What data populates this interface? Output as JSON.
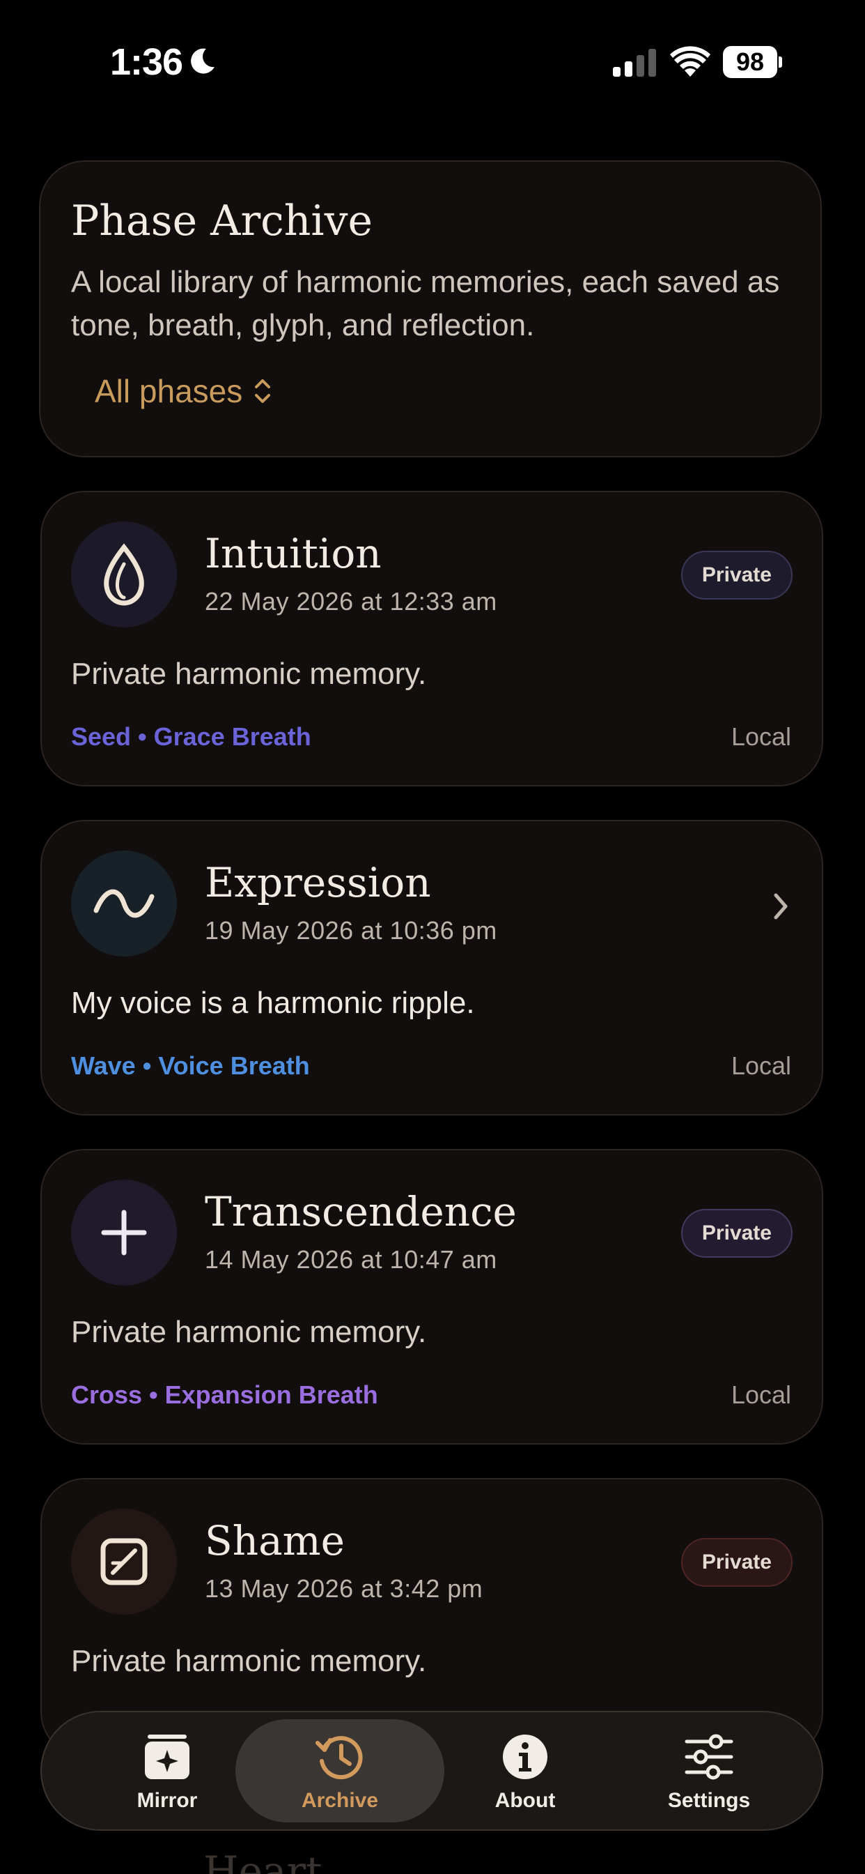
{
  "status_bar": {
    "time": "1:36",
    "battery": "98",
    "icons": [
      "moon-icon",
      "signal-icon",
      "wifi-icon",
      "battery-icon"
    ]
  },
  "header": {
    "title": "Phase Archive",
    "description": "A local library of harmonic memories, each saved as tone, breath, glyph, and reflection.",
    "filter_label": "All phases"
  },
  "entries": [
    {
      "title": "Intuition",
      "date": "22 May 2026 at 12:33 am",
      "badge": "Private",
      "text": "Private harmonic memory.",
      "tags": "Seed • Grace Breath",
      "storage": "Local",
      "icon": "seed-glyph-icon",
      "tag_color": "#6b63d8"
    },
    {
      "title": "Expression",
      "date": "19 May 2026 at 10:36 pm",
      "text": "My voice is a harmonic ripple.",
      "tags": "Wave • Voice Breath",
      "storage": "Local",
      "icon": "wave-glyph-icon",
      "tag_color": "#4f8fe0"
    },
    {
      "title": "Transcendence",
      "date": "14 May 2026 at 10:47 am",
      "badge": "Private",
      "text": "Private harmonic memory.",
      "tags": "Cross • Expansion Breath",
      "storage": "Local",
      "icon": "cross-glyph-icon",
      "tag_color": "#9b6ee0"
    },
    {
      "title": "Shame",
      "date": "13 May 2026 at 3:42 pm",
      "badge": "Private",
      "text": "Private harmonic memory.",
      "icon": "slashed-square-glyph-icon"
    }
  ],
  "peek_entry": {
    "title": "Heart"
  },
  "tab_bar": {
    "tabs": [
      {
        "label": "Mirror",
        "icon": "mirror-icon",
        "active": false
      },
      {
        "label": "Archive",
        "icon": "history-icon",
        "active": true
      },
      {
        "label": "About",
        "icon": "info-icon",
        "active": false
      },
      {
        "label": "Settings",
        "icon": "sliders-icon",
        "active": false
      }
    ],
    "active_color": "#d29a5c"
  }
}
